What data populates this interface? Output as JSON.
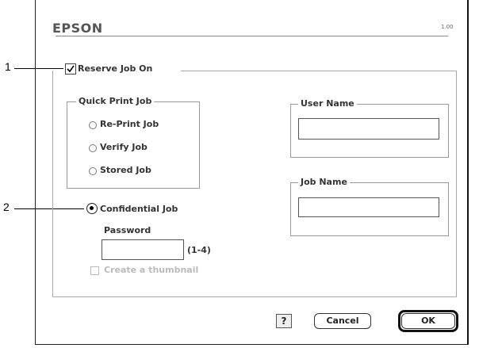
{
  "callouts": {
    "one": "1",
    "two": "2"
  },
  "header": {
    "brand": "EPSON",
    "version": "1.00"
  },
  "reserve_job": {
    "label": "Reserve Job On",
    "checked": true
  },
  "quick_print": {
    "title": "Quick Print Job",
    "options": [
      "Re-Print Job",
      "Verify Job",
      "Stored Job"
    ]
  },
  "confidential": {
    "label": "Confidential Job",
    "selected": true,
    "password_label": "Password",
    "password_value": "",
    "password_hint": "(1-4)",
    "thumbnail_label": "Create a thumbnail"
  },
  "user_name": {
    "title": "User Name",
    "value": ""
  },
  "job_name": {
    "title": "Job Name",
    "value": ""
  },
  "buttons": {
    "help": "?",
    "cancel": "Cancel",
    "ok": "OK"
  }
}
